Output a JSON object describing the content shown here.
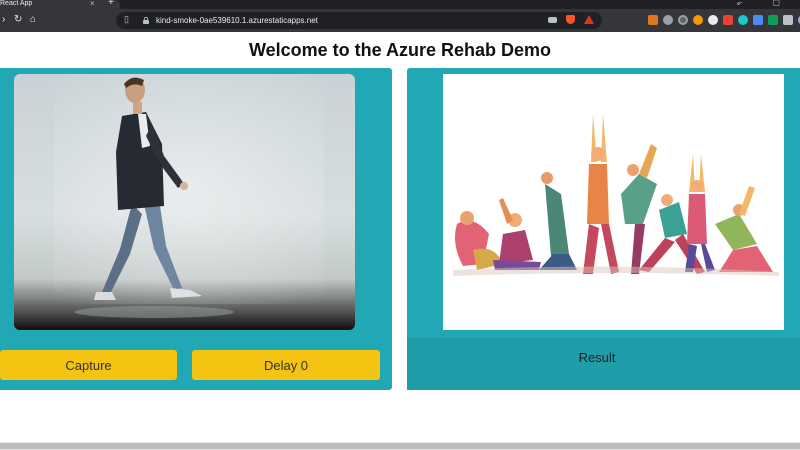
{
  "browser": {
    "tab_title": "React App",
    "tab_close": "×",
    "new_tab": "+",
    "url": "kind-smoke-0ae539610.1.azurestaticapps.net",
    "back": "‹",
    "forward": "›",
    "reload": "↻",
    "home": "⌂",
    "window_controls": "⌄ – ▢",
    "icons": [
      "bookmark-icon",
      "lock-icon",
      "camera-icon",
      "brave-shield-icon",
      "brave-rewards-icon"
    ]
  },
  "page": {
    "title": "Welcome to the Azure Rehab Demo"
  },
  "camera_panel": {
    "capture_label": "Capture",
    "delay_label": "Delay 0"
  },
  "result_panel": {
    "result_label": "Result"
  },
  "colors": {
    "panel": "#22a7b4",
    "button": "#f5c312",
    "chrome_dark": "#202124",
    "chrome_toolbar": "#35363a"
  }
}
